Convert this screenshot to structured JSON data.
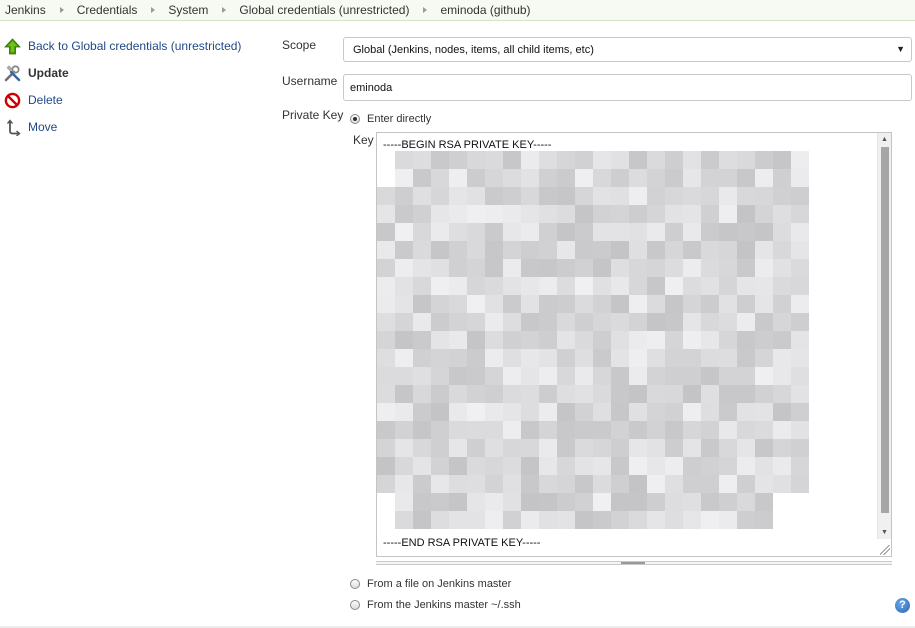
{
  "breadcrumb": [
    "Jenkins",
    "Credentials",
    "System",
    "Global credentials (unrestricted)",
    "eminoda (github)"
  ],
  "side_panel": {
    "back": "Back to Global credentials (unrestricted)",
    "update": "Update",
    "delete": "Delete",
    "move": "Move",
    "icons": [
      "up-arrow-icon",
      "tools-icon",
      "no-entry-icon",
      "move-icon"
    ]
  },
  "form": {
    "scope_label": "Scope",
    "scope_value": "Global (Jenkins, nodes, items, all child items, etc)",
    "username_label": "Username",
    "username_value": "eminoda",
    "private_key_label": "Private Key",
    "options": {
      "enter_directly": "Enter directly",
      "from_file": "From a file on Jenkins master",
      "from_ssh": "From the Jenkins master ~/.ssh"
    },
    "selected_option": "enter_directly",
    "key_label": "Key",
    "key_begin": "-----BEGIN RSA PRIVATE KEY-----",
    "key_end": "-----END RSA PRIVATE KEY-----"
  },
  "help_icon": "?",
  "colors": {
    "link": "#204a87",
    "breadcrumb_bg": "#f6faf2",
    "help": "#2a64b6"
  }
}
